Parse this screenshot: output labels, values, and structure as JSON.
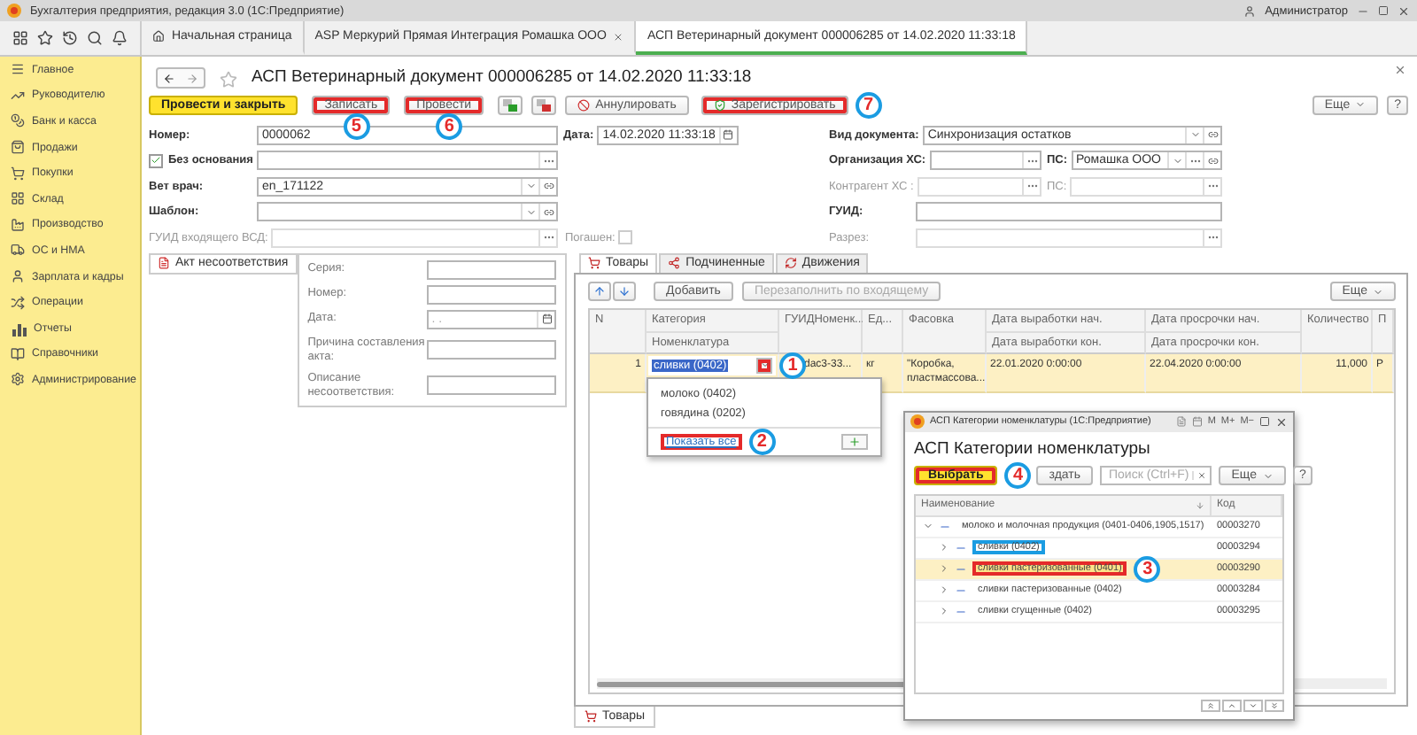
{
  "app_title": "Бухгалтерия предприятия, редакция 3.0 (1С:Предприятие)",
  "user": "Администратор",
  "open_tabs": [
    {
      "label": "Начальная страница",
      "kind": "home",
      "selected": false
    },
    {
      "label": "ASP Меркурий Прямая Интеграция Ромашка ООО",
      "kind": "closable",
      "selected": false
    },
    {
      "label": "АСП Ветеринарный документ 000006285 от 14.02.2020 11:33:18",
      "kind": "plain",
      "selected": true
    }
  ],
  "sidebar": [
    {
      "label": "Главное"
    },
    {
      "label": "Руководителю"
    },
    {
      "label": "Банк и касса"
    },
    {
      "label": "Продажи"
    },
    {
      "label": "Покупки"
    },
    {
      "label": "Склад"
    },
    {
      "label": "Производство"
    },
    {
      "label": "ОС и НМА"
    },
    {
      "label": "Зарплата и кадры"
    },
    {
      "label": "Операции"
    },
    {
      "label": "Отчеты"
    },
    {
      "label": "Справочники"
    },
    {
      "label": "Администрирование"
    }
  ],
  "document": {
    "title": "АСП Ветеринарный документ 000006285 от 14.02.2020 11:33:18",
    "commands": [
      {
        "kind": "primary",
        "label": "Провести и закрыть",
        "highlighted": false
      },
      {
        "kind": "text",
        "label": "Записать",
        "highlighted": true,
        "callout": "5"
      },
      {
        "kind": "text",
        "label": "Провести",
        "highlighted": true,
        "callout": "6"
      },
      {
        "kind": "ledger-green",
        "highlighted": false
      },
      {
        "kind": "ledger-red",
        "highlighted": false
      },
      {
        "kind": "cancel",
        "label": "Аннулировать",
        "highlighted": false
      },
      {
        "kind": "register",
        "label": "Зарегистрировать",
        "highlighted": true,
        "callout": "7"
      }
    ],
    "more": "Еще",
    "help": "?",
    "left_rows": [
      [
        {
          "kind": "field",
          "label": "Номер:",
          "value": "0000062",
          "disabled": false
        },
        {
          "kind": "field",
          "label": "Дата:",
          "value": "14.02.2020 11:33:18",
          "disabled": false,
          "buttons": [
            {
              "kind": "calendar"
            }
          ]
        }
      ],
      [
        {
          "kind": "checked-field",
          "label": "Без основания",
          "checked": true,
          "disabled": false,
          "buttons": [
            {
              "kind": "pick"
            }
          ]
        }
      ],
      [
        {
          "kind": "field",
          "label": "Вет врач:",
          "value": "en_171122",
          "disabled": false,
          "buttons": [
            {
              "kind": "dropdown"
            },
            {
              "kind": "link"
            }
          ]
        }
      ],
      [
        {
          "kind": "field",
          "label": "Шаблон:",
          "disabled": false,
          "buttons": [
            {
              "kind": "dropdown"
            },
            {
              "kind": "link"
            }
          ]
        }
      ],
      [
        {
          "kind": "field",
          "label": "ГУИД входящего ВСД:",
          "disabled": true,
          "buttons": [
            {
              "kind": "pick"
            }
          ]
        },
        {
          "kind": "checkbox",
          "label": "Погашен:",
          "checked": false,
          "disabled": true
        }
      ]
    ],
    "right_rows": [
      [
        {
          "kind": "field",
          "label": "Вид документа:",
          "value": "Синхронизация остатков",
          "disabled": false,
          "buttons": [
            {
              "kind": "dropdown"
            },
            {
              "kind": "link"
            }
          ]
        }
      ],
      [
        {
          "kind": "field",
          "label": "Организация ХС:",
          "disabled": false,
          "buttons": [
            {
              "kind": "pick"
            }
          ]
        },
        {
          "kind": "field",
          "label": "ПС:",
          "value": "Ромашка ООО",
          "disabled": false,
          "buttons": [
            {
              "kind": "dropdown"
            },
            {
              "kind": "pick"
            },
            {
              "kind": "link"
            }
          ]
        }
      ],
      [
        {
          "kind": "field",
          "label": "Контрагент ХС :",
          "disabled": true,
          "buttons": [
            {
              "kind": "pick"
            }
          ]
        },
        {
          "kind": "field",
          "label": "ПС:",
          "disabled": true,
          "buttons": [
            {
              "kind": "pick"
            }
          ]
        }
      ],
      [
        {
          "kind": "field",
          "label": "ГУИД:",
          "disabled": false
        }
      ],
      [
        {
          "kind": "field",
          "label": "Разрез:",
          "disabled": true,
          "buttons": [
            {
              "kind": "pick"
            }
          ]
        }
      ]
    ],
    "act_tab": "Акт несоответствия",
    "act_fields": [
      {
        "label": "Серия:",
        "kind": "text"
      },
      {
        "label": "Номер:",
        "kind": "text"
      },
      {
        "label": "Дата:",
        "kind": "date",
        "placeholder": ". ."
      },
      {
        "label": "Причина составления акта:",
        "kind": "text"
      },
      {
        "label": "Описание несоответствия:",
        "kind": "text"
      }
    ],
    "tabs": [
      {
        "label": "Товары",
        "selected": true
      },
      {
        "label": "Подчиненные",
        "selected": false
      },
      {
        "label": "Движения",
        "selected": false
      }
    ],
    "goods": {
      "add": "Добавить",
      "refill": "Перезаполнить по входящему",
      "more": "Еще",
      "columns": [
        {
          "top": "N"
        },
        {
          "top": "Категория",
          "bottom": "Номенклатура"
        },
        {
          "top": "ГУИДНоменк..."
        },
        {
          "top": "Ед..."
        },
        {
          "top": "Фасовка"
        },
        {
          "top": "Дата выработки нач.",
          "bottom": "Дата выработки кон."
        },
        {
          "top": "Дата просрочки нач.",
          "bottom": "Дата просрочки кон."
        },
        {
          "top": "Количество"
        },
        {
          "top": "П"
        }
      ],
      "rows": [
        {
          "selected": true,
          "cells": [
            "1",
            "сливки (0402)",
            "dac3-33...",
            "кг",
            "\"Коробка, пластмассова...",
            "22.01.2020 0:00:00",
            "22.04.2020 0:00:00",
            "11,000",
            "Р"
          ],
          "dropdown_highlighted": true,
          "callout": "1"
        }
      ]
    },
    "bottom_tab": "Товары"
  },
  "dropdown": {
    "options": [
      "молоко (0402)",
      "говядина (0202)"
    ],
    "show_all": "Показать все",
    "show_all_highlighted": true,
    "callout": "2"
  },
  "picker": {
    "window_title": "АСП Категории номенклатуры (1С:Предприятие)",
    "memory_buttons": [
      "M",
      "M+",
      "M−"
    ],
    "heading": "АСП Категории номенклатуры",
    "select": "Выбрать",
    "select_highlighted": true,
    "callout": "4",
    "create": "здать",
    "search_placeholder": "Поиск (Ctrl+F)",
    "more": "Еще",
    "help": "?",
    "columns": [
      "Наименование",
      "Код"
    ],
    "tree": [
      {
        "name": "молоко и молочная продукция (0401-0406,1905,1517)",
        "code": "00003270",
        "expanded": true,
        "selected": false,
        "highlighted": false,
        "hinted": false,
        "children": [
          {
            "name": "сливки (0402)",
            "code": "00003294",
            "expanded": false,
            "selected": false,
            "highlighted": false,
            "hinted": true
          },
          {
            "name": "сливки пастеризованные (0401)",
            "code": "00003290",
            "expanded": false,
            "selected": true,
            "highlighted": true,
            "hinted": false,
            "callout": "3"
          },
          {
            "name": "сливки пастеризованные (0402)",
            "code": "00003284",
            "expanded": false,
            "selected": false,
            "highlighted": false,
            "hinted": false
          },
          {
            "name": "сливки сгущенные (0402)",
            "code": "00003295",
            "expanded": false,
            "selected": false,
            "highlighted": false,
            "hinted": false
          }
        ]
      }
    ]
  }
}
